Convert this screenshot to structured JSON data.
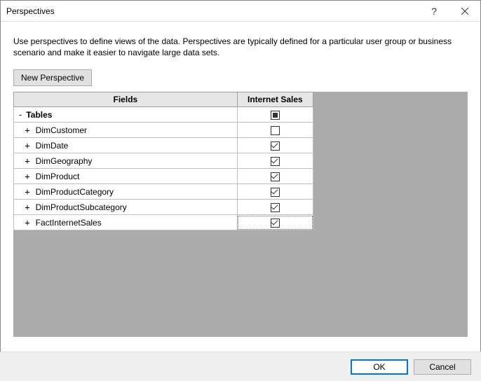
{
  "window": {
    "title": "Perspectives"
  },
  "description": "Use perspectives to define views of the data. Perspectives are typically defined for a particular user group or business scenario and make it easier to navigate large data sets.",
  "buttons": {
    "new_perspective": "New Perspective",
    "ok": "OK",
    "cancel": "Cancel"
  },
  "grid": {
    "headers": {
      "fields": "Fields",
      "perspective1": "Internet Sales"
    },
    "top": {
      "expander": "-",
      "label": "Tables",
      "state": "filled"
    },
    "rows": [
      {
        "expander": "+",
        "label": "DimCustomer",
        "checked": false
      },
      {
        "expander": "+",
        "label": "DimDate",
        "checked": true
      },
      {
        "expander": "+",
        "label": "DimGeography",
        "checked": true
      },
      {
        "expander": "+",
        "label": "DimProduct",
        "checked": true
      },
      {
        "expander": "+",
        "label": "DimProductCategory",
        "checked": true
      },
      {
        "expander": "+",
        "label": "DimProductSubcategory",
        "checked": true
      },
      {
        "expander": "+",
        "label": "FactInternetSales",
        "checked": true
      }
    ]
  }
}
